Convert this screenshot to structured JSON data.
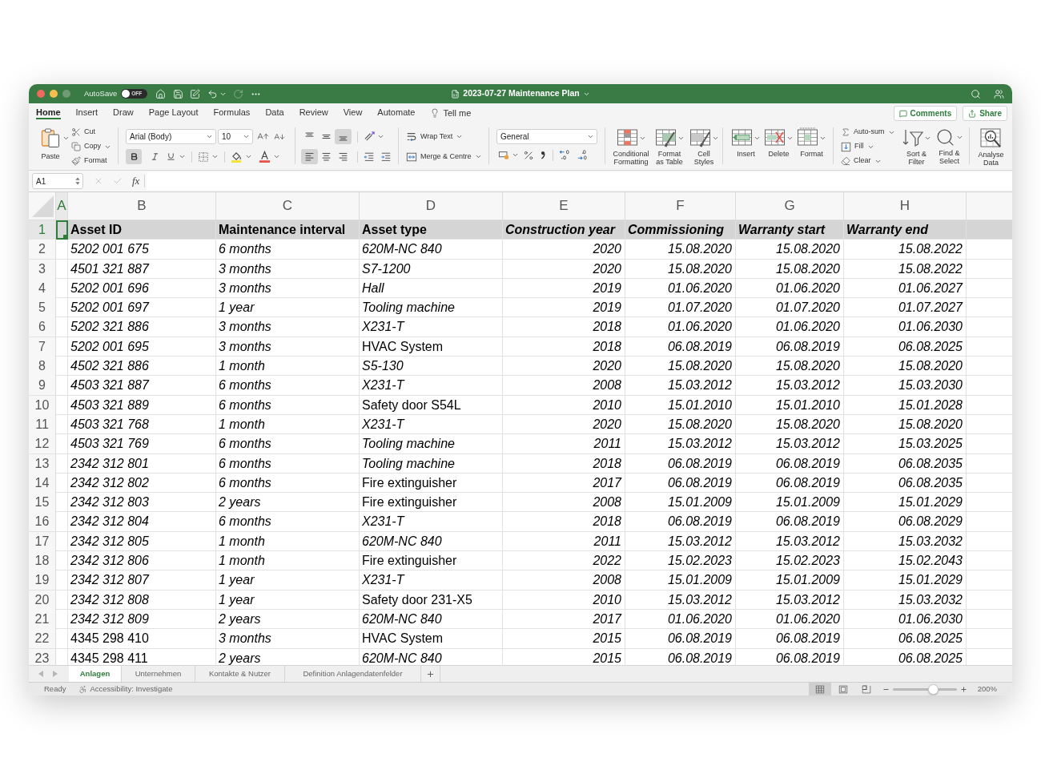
{
  "window": {
    "title": "2023-07-27 Maintenance Plan",
    "autosave": {
      "label": "AutoSave",
      "on": false,
      "state": "OFF"
    }
  },
  "ribbon_tabs": [
    {
      "label": "Home",
      "selected": true
    },
    {
      "label": "Insert",
      "selected": false
    },
    {
      "label": "Draw",
      "selected": false
    },
    {
      "label": "Page Layout",
      "selected": false
    },
    {
      "label": "Formulas",
      "selected": false
    },
    {
      "label": "Data",
      "selected": false
    },
    {
      "label": "Review",
      "selected": false
    },
    {
      "label": "View",
      "selected": false
    },
    {
      "label": "Automate",
      "selected": false
    }
  ],
  "tell_me": "Tell me",
  "header_buttons": [
    {
      "kind": "comments",
      "label": "Comments"
    },
    {
      "kind": "share",
      "label": "Share"
    }
  ],
  "ribbon": {
    "clipboard": {
      "paste": "Paste",
      "cut": "Cut",
      "copy": "Copy",
      "format": "Format"
    },
    "font": {
      "family": "Arial (Body)",
      "size": "10",
      "bold": true,
      "italic": false,
      "underline": false
    },
    "alignment": {
      "vertical": [
        {
          "kind": "top",
          "selected": false
        },
        {
          "kind": "middle",
          "selected": false
        },
        {
          "kind": "bottom",
          "selected": true
        }
      ],
      "horizontal": [
        {
          "kind": "left",
          "selected": true
        },
        {
          "kind": "center",
          "selected": false
        },
        {
          "kind": "right",
          "selected": false
        }
      ],
      "wrap_text": "Wrap Text",
      "merge": "Merge & Centre"
    },
    "number": {
      "format": "General"
    },
    "styles": [
      {
        "kind": "conditional",
        "label": "Conditional\nFormatting"
      },
      {
        "kind": "table",
        "label": "Format\nas Table"
      },
      {
        "kind": "cell_styles",
        "label": "Cell\nStyles"
      }
    ],
    "cells": [
      {
        "kind": "insert",
        "label": "Insert"
      },
      {
        "kind": "delete",
        "label": "Delete"
      },
      {
        "kind": "format",
        "label": "Format"
      }
    ],
    "editing": {
      "autosum": "Auto-sum",
      "fill": "Fill",
      "clear": "Clear",
      "sort": "Sort &\nFilter",
      "find": "Find &\nSelect"
    },
    "analyse": "Analyse\nData"
  },
  "formula_bar": {
    "name_box": "A1",
    "function_label": "fx"
  },
  "sheet": {
    "columns": [
      {
        "label": "A",
        "selected": true,
        "kind": "text"
      },
      {
        "label": "B",
        "selected": false,
        "kind": "text"
      },
      {
        "label": "C",
        "selected": false,
        "kind": "text"
      },
      {
        "label": "D",
        "selected": false,
        "kind": "text"
      },
      {
        "label": "E",
        "selected": false,
        "kind": "number"
      },
      {
        "label": "F",
        "selected": false,
        "kind": "number"
      },
      {
        "label": "G",
        "selected": false,
        "kind": "number"
      },
      {
        "label": "H",
        "selected": false,
        "kind": "number"
      }
    ],
    "rows": [
      {
        "number": "1",
        "selected": true,
        "kind": "header",
        "cells": [
          {
            "text": ""
          },
          {
            "text": "Asset ID",
            "italic": false
          },
          {
            "text": "Maintenance interval",
            "italic": false
          },
          {
            "text": "Asset type",
            "italic": false
          },
          {
            "text": "Construction year",
            "italic": true
          },
          {
            "text": "Commissioning",
            "italic": true
          },
          {
            "text": "Warranty start",
            "italic": true
          },
          {
            "text": "Warranty end",
            "italic": true
          }
        ]
      },
      {
        "number": "2",
        "selected": false,
        "kind": "data",
        "cells": [
          {
            "text": ""
          },
          {
            "text": "5202 001 675",
            "italic": true
          },
          {
            "text": "6 months",
            "italic": true
          },
          {
            "text": "620M-NC 840",
            "italic": true
          },
          {
            "text": "2020",
            "italic": true
          },
          {
            "text": "15.08.2020",
            "italic": true
          },
          {
            "text": "15.08.2020",
            "italic": true
          },
          {
            "text": "15.08.2022",
            "italic": true
          }
        ]
      },
      {
        "number": "3",
        "selected": false,
        "kind": "data",
        "cells": [
          {
            "text": ""
          },
          {
            "text": "4501 321 887",
            "italic": true
          },
          {
            "text": "3 months",
            "italic": true
          },
          {
            "text": "S7-1200",
            "italic": true
          },
          {
            "text": "2020",
            "italic": true
          },
          {
            "text": "15.08.2020",
            "italic": true
          },
          {
            "text": "15.08.2020",
            "italic": true
          },
          {
            "text": "15.08.2022",
            "italic": true
          }
        ]
      },
      {
        "number": "4",
        "selected": false,
        "kind": "data",
        "cells": [
          {
            "text": ""
          },
          {
            "text": "5202 001 696",
            "italic": true
          },
          {
            "text": "3 months",
            "italic": true
          },
          {
            "text": "Hall",
            "italic": true
          },
          {
            "text": "2019",
            "italic": true
          },
          {
            "text": "01.06.2020",
            "italic": true
          },
          {
            "text": "01.06.2020",
            "italic": true
          },
          {
            "text": "01.06.2027",
            "italic": true
          }
        ]
      },
      {
        "number": "5",
        "selected": false,
        "kind": "data",
        "cells": [
          {
            "text": ""
          },
          {
            "text": "5202 001 697",
            "italic": true
          },
          {
            "text": "1 year",
            "italic": true
          },
          {
            "text": "Tooling machine",
            "italic": true
          },
          {
            "text": "2019",
            "italic": true
          },
          {
            "text": "01.07.2020",
            "italic": true
          },
          {
            "text": "01.07.2020",
            "italic": true
          },
          {
            "text": "01.07.2027",
            "italic": true
          }
        ]
      },
      {
        "number": "6",
        "selected": false,
        "kind": "data",
        "cells": [
          {
            "text": ""
          },
          {
            "text": "5202 321 886",
            "italic": true
          },
          {
            "text": "3 months",
            "italic": true
          },
          {
            "text": "X231-T",
            "italic": true
          },
          {
            "text": "2018",
            "italic": true
          },
          {
            "text": "01.06.2020",
            "italic": true
          },
          {
            "text": "01.06.2020",
            "italic": true
          },
          {
            "text": "01.06.2030",
            "italic": true
          }
        ]
      },
      {
        "number": "7",
        "selected": false,
        "kind": "data",
        "cells": [
          {
            "text": ""
          },
          {
            "text": "5202 001 695",
            "italic": true
          },
          {
            "text": "3 months",
            "italic": true
          },
          {
            "text": "HVAC System",
            "italic": false
          },
          {
            "text": "2018",
            "italic": true
          },
          {
            "text": "06.08.2019",
            "italic": true
          },
          {
            "text": "06.08.2019",
            "italic": true
          },
          {
            "text": "06.08.2025",
            "italic": true
          }
        ]
      },
      {
        "number": "8",
        "selected": false,
        "kind": "data",
        "cells": [
          {
            "text": ""
          },
          {
            "text": "4502 321 886",
            "italic": true
          },
          {
            "text": "1 month",
            "italic": true
          },
          {
            "text": "S5-130",
            "italic": true
          },
          {
            "text": "2020",
            "italic": true
          },
          {
            "text": "15.08.2020",
            "italic": true
          },
          {
            "text": "15.08.2020",
            "italic": true
          },
          {
            "text": "15.08.2020",
            "italic": true
          }
        ]
      },
      {
        "number": "9",
        "selected": false,
        "kind": "data",
        "cells": [
          {
            "text": ""
          },
          {
            "text": "4503 321 887",
            "italic": true
          },
          {
            "text": "6 months",
            "italic": true
          },
          {
            "text": "X231-T",
            "italic": true
          },
          {
            "text": "2008",
            "italic": true
          },
          {
            "text": "15.03.2012",
            "italic": true
          },
          {
            "text": "15.03.2012",
            "italic": true
          },
          {
            "text": "15.03.2030",
            "italic": true
          }
        ]
      },
      {
        "number": "10",
        "selected": false,
        "kind": "data",
        "cells": [
          {
            "text": ""
          },
          {
            "text": "4503 321 889",
            "italic": true
          },
          {
            "text": "6 months",
            "italic": true
          },
          {
            "text": "Safety door S54L",
            "italic": false
          },
          {
            "text": "2010",
            "italic": true
          },
          {
            "text": "15.01.2010",
            "italic": true
          },
          {
            "text": "15.01.2010",
            "italic": true
          },
          {
            "text": "15.01.2028",
            "italic": true
          }
        ]
      },
      {
        "number": "11",
        "selected": false,
        "kind": "data",
        "cells": [
          {
            "text": ""
          },
          {
            "text": "4503 321 768",
            "italic": true
          },
          {
            "text": "1 month",
            "italic": true
          },
          {
            "text": "X231-T",
            "italic": true
          },
          {
            "text": "2020",
            "italic": true
          },
          {
            "text": "15.08.2020",
            "italic": true
          },
          {
            "text": "15.08.2020",
            "italic": true
          },
          {
            "text": "15.08.2020",
            "italic": true
          }
        ]
      },
      {
        "number": "12",
        "selected": false,
        "kind": "data",
        "cells": [
          {
            "text": ""
          },
          {
            "text": "4503 321 769",
            "italic": true
          },
          {
            "text": "6 months",
            "italic": true
          },
          {
            "text": "Tooling machine",
            "italic": true
          },
          {
            "text": "2011",
            "italic": true
          },
          {
            "text": "15.03.2012",
            "italic": true
          },
          {
            "text": "15.03.2012",
            "italic": true
          },
          {
            "text": "15.03.2025",
            "italic": true
          }
        ]
      },
      {
        "number": "13",
        "selected": false,
        "kind": "data",
        "cells": [
          {
            "text": ""
          },
          {
            "text": "2342 312 801",
            "italic": true
          },
          {
            "text": "6 months",
            "italic": true
          },
          {
            "text": "Tooling machine",
            "italic": true
          },
          {
            "text": "2018",
            "italic": true
          },
          {
            "text": "06.08.2019",
            "italic": true
          },
          {
            "text": "06.08.2019",
            "italic": true
          },
          {
            "text": "06.08.2035",
            "italic": true
          }
        ]
      },
      {
        "number": "14",
        "selected": false,
        "kind": "data",
        "cells": [
          {
            "text": ""
          },
          {
            "text": "2342 312 802",
            "italic": true
          },
          {
            "text": "6 months",
            "italic": true
          },
          {
            "text": "Fire extinguisher",
            "italic": false
          },
          {
            "text": "2017",
            "italic": true
          },
          {
            "text": "06.08.2019",
            "italic": true
          },
          {
            "text": "06.08.2019",
            "italic": true
          },
          {
            "text": "06.08.2035",
            "italic": true
          }
        ]
      },
      {
        "number": "15",
        "selected": false,
        "kind": "data",
        "cells": [
          {
            "text": ""
          },
          {
            "text": "2342 312 803",
            "italic": true
          },
          {
            "text": "2 years",
            "italic": true
          },
          {
            "text": "Fire extinguisher",
            "italic": false
          },
          {
            "text": "2008",
            "italic": true
          },
          {
            "text": "15.01.2009",
            "italic": true
          },
          {
            "text": "15.01.2009",
            "italic": true
          },
          {
            "text": "15.01.2029",
            "italic": true
          }
        ]
      },
      {
        "number": "16",
        "selected": false,
        "kind": "data",
        "cells": [
          {
            "text": ""
          },
          {
            "text": "2342 312 804",
            "italic": true
          },
          {
            "text": "6 months",
            "italic": true
          },
          {
            "text": "X231-T",
            "italic": true
          },
          {
            "text": "2018",
            "italic": true
          },
          {
            "text": "06.08.2019",
            "italic": true
          },
          {
            "text": "06.08.2019",
            "italic": true
          },
          {
            "text": "06.08.2029",
            "italic": true
          }
        ]
      },
      {
        "number": "17",
        "selected": false,
        "kind": "data",
        "cells": [
          {
            "text": ""
          },
          {
            "text": "2342 312 805",
            "italic": true
          },
          {
            "text": "1 month",
            "italic": true
          },
          {
            "text": "620M-NC 840",
            "italic": true
          },
          {
            "text": "2011",
            "italic": true
          },
          {
            "text": "15.03.2012",
            "italic": true
          },
          {
            "text": "15.03.2012",
            "italic": true
          },
          {
            "text": "15.03.2032",
            "italic": true
          }
        ]
      },
      {
        "number": "18",
        "selected": false,
        "kind": "data",
        "cells": [
          {
            "text": ""
          },
          {
            "text": "2342 312 806",
            "italic": true
          },
          {
            "text": "1 month",
            "italic": true
          },
          {
            "text": "Fire extinguisher",
            "italic": false
          },
          {
            "text": "2022",
            "italic": true
          },
          {
            "text": "15.02.2023",
            "italic": true
          },
          {
            "text": "15.02.2023",
            "italic": true
          },
          {
            "text": "15.02.2043",
            "italic": true
          }
        ]
      },
      {
        "number": "19",
        "selected": false,
        "kind": "data",
        "cells": [
          {
            "text": ""
          },
          {
            "text": "2342 312 807",
            "italic": true
          },
          {
            "text": "1 year",
            "italic": true
          },
          {
            "text": "X231-T",
            "italic": true
          },
          {
            "text": "2008",
            "italic": true
          },
          {
            "text": "15.01.2009",
            "italic": true
          },
          {
            "text": "15.01.2009",
            "italic": true
          },
          {
            "text": "15.01.2029",
            "italic": true
          }
        ]
      },
      {
        "number": "20",
        "selected": false,
        "kind": "data",
        "cells": [
          {
            "text": ""
          },
          {
            "text": "2342 312 808",
            "italic": true
          },
          {
            "text": "1 year",
            "italic": true
          },
          {
            "text": "Safety door 231-X5",
            "italic": false
          },
          {
            "text": "2010",
            "italic": true
          },
          {
            "text": "15.03.2012",
            "italic": true
          },
          {
            "text": "15.03.2012",
            "italic": true
          },
          {
            "text": "15.03.2032",
            "italic": true
          }
        ]
      },
      {
        "number": "21",
        "selected": false,
        "kind": "data",
        "cells": [
          {
            "text": ""
          },
          {
            "text": "2342 312 809",
            "italic": true
          },
          {
            "text": "2 years",
            "italic": true
          },
          {
            "text": "620M-NC 840",
            "italic": true
          },
          {
            "text": "2017",
            "italic": true
          },
          {
            "text": "01.06.2020",
            "italic": true
          },
          {
            "text": "01.06.2020",
            "italic": true
          },
          {
            "text": "01.06.2030",
            "italic": true
          }
        ]
      },
      {
        "number": "22",
        "selected": false,
        "kind": "data",
        "cells": [
          {
            "text": ""
          },
          {
            "text": "4345 298 410",
            "italic": false
          },
          {
            "text": "3 months",
            "italic": true
          },
          {
            "text": "HVAC System",
            "italic": false
          },
          {
            "text": "2015",
            "italic": true
          },
          {
            "text": "06.08.2019",
            "italic": true
          },
          {
            "text": "06.08.2019",
            "italic": true
          },
          {
            "text": "06.08.2025",
            "italic": true
          }
        ]
      },
      {
        "number": "23",
        "selected": false,
        "kind": "data",
        "cells": [
          {
            "text": ""
          },
          {
            "text": "4345 298 411",
            "italic": false
          },
          {
            "text": "2 years",
            "italic": true
          },
          {
            "text": "620M-NC 840",
            "italic": true
          },
          {
            "text": "2015",
            "italic": true
          },
          {
            "text": "06.08.2019",
            "italic": true
          },
          {
            "text": "06.08.2019",
            "italic": true
          },
          {
            "text": "06.08.2025",
            "italic": true
          }
        ]
      }
    ]
  },
  "sheet_tabs": [
    {
      "label": "Anlagen",
      "selected": true
    },
    {
      "label": "Unternehmen",
      "selected": false
    },
    {
      "label": "Kontakte & Nutzer",
      "selected": false
    },
    {
      "label": "Definition Anlagendatenfelder",
      "selected": false
    }
  ],
  "status_bar": {
    "status": "Ready",
    "accessibility": "Accessibility: Investigate",
    "views": [
      {
        "kind": "normal",
        "selected": true
      },
      {
        "kind": "page_layout",
        "selected": false
      },
      {
        "kind": "page_break",
        "selected": false
      }
    ],
    "zoom": {
      "level": 0.64,
      "reading": "200%"
    }
  }
}
